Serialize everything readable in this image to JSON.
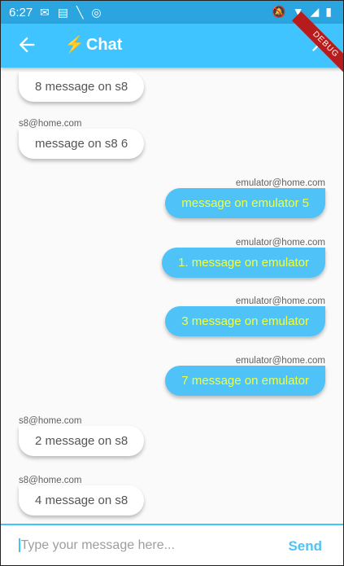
{
  "status_bar": {
    "time": "6:27"
  },
  "app_bar": {
    "title": "Chat",
    "debug_label": "DEBUG"
  },
  "messages": [
    {
      "side": "left",
      "sender": "",
      "text": "8 message on s8"
    },
    {
      "side": "left",
      "sender": "s8@home.com",
      "text": "message on s8 6"
    },
    {
      "side": "right",
      "sender": "emulator@home.com",
      "text": "message on emulator 5"
    },
    {
      "side": "right",
      "sender": "emulator@home.com",
      "text": "1. message on emulator"
    },
    {
      "side": "right",
      "sender": "emulator@home.com",
      "text": "3 message on emulator"
    },
    {
      "side": "right",
      "sender": "emulator@home.com",
      "text": "7 message on emulator"
    },
    {
      "side": "left",
      "sender": "s8@home.com",
      "text": "2 message on s8"
    },
    {
      "side": "left",
      "sender": "s8@home.com",
      "text": "4 message on s8"
    }
  ],
  "composer": {
    "placeholder": "Type your message here...",
    "send_label": "Send"
  },
  "colors": {
    "app_bar": "#40c4ff",
    "status_bar": "#2aa5df",
    "outgoing_bubble": "#4fc3f7",
    "outgoing_text": "#eeff41"
  }
}
